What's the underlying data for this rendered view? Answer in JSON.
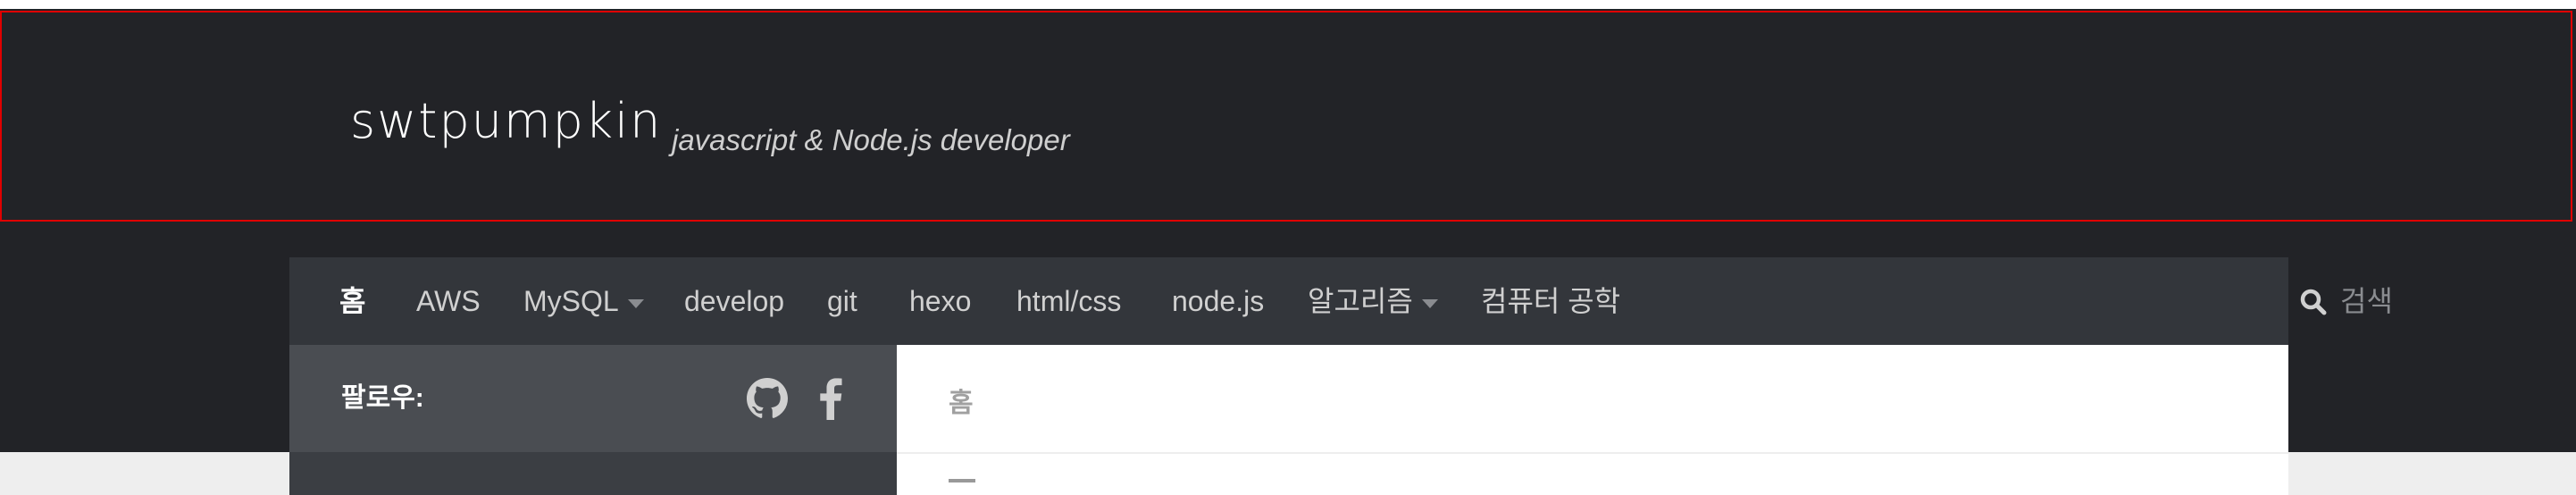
{
  "site": {
    "title": "swtpumpkin",
    "description": "javascript & Node.js developer"
  },
  "nav": {
    "items": [
      {
        "label": "홈",
        "active": true
      },
      {
        "label": "AWS"
      },
      {
        "label": "MySQL",
        "dropdown": true
      },
      {
        "label": "develop"
      },
      {
        "label": "git"
      },
      {
        "label": "hexo"
      },
      {
        "label": "html/css"
      },
      {
        "label": "node.js"
      },
      {
        "label": "알고리즘",
        "dropdown": true
      },
      {
        "label": "컴퓨터 공학"
      }
    ],
    "search": {
      "placeholder": "검색",
      "icon": "search-icon"
    }
  },
  "sidebar": {
    "follow_label": "팔로우:",
    "social": [
      "github-icon",
      "facebook-icon"
    ]
  },
  "content": {
    "breadcrumb": "홈"
  },
  "colors": {
    "header_bg": "#222327",
    "nav_bg": "#33363b",
    "sidebar_bg": "#4a4d52",
    "outline": "#e00000"
  }
}
